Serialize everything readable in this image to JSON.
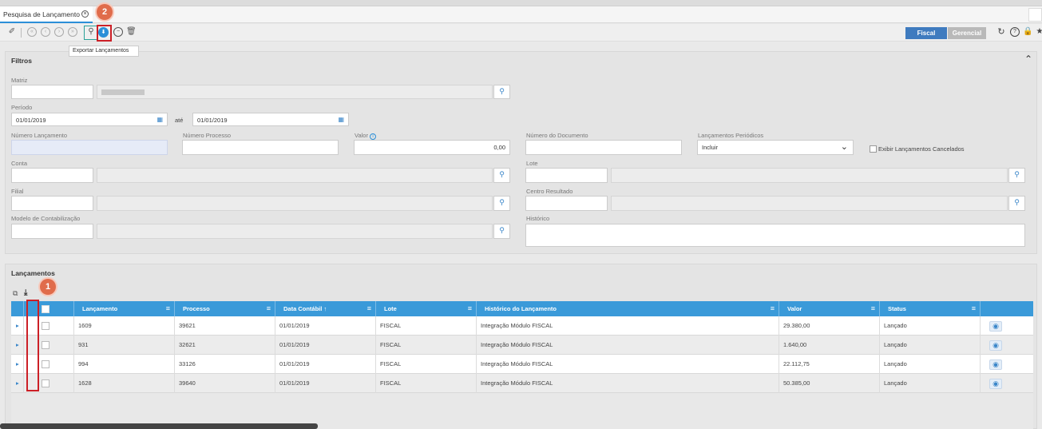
{
  "tab": {
    "title": "Pesquisa de Lançamento"
  },
  "annotations": {
    "badge1": "1",
    "badge2": "2"
  },
  "tooltip": "Exportar Lançamentos",
  "view_toggle": {
    "fiscal": "Fiscal",
    "gerencial": "Gerencial"
  },
  "filters": {
    "title": "Filtros",
    "matriz_label": "Matriz",
    "periodo_label": "Período",
    "periodo_de": "01/01/2019",
    "ate_label": "até",
    "periodo_ate": "01/01/2019",
    "numero_lancamento_label": "Número Lançamento",
    "numero_processo_label": "Número Processo",
    "valor_label": "Valor",
    "valor_value": "0,00",
    "numero_documento_label": "Número do Documento",
    "lanc_periodicos_label": "Lançamentos Periódicos",
    "lanc_periodicos_value": "Incluir",
    "exibir_cancelados_label": "Exibir Lançamentos Cancelados",
    "conta_label": "Conta",
    "lote_label": "Lote",
    "filial_label": "Filial",
    "centro_resultado_label": "Centro Resultado",
    "modelo_label": "Modelo de Contabilização",
    "historico_label": "Histórico"
  },
  "lancamentos": {
    "title": "Lançamentos",
    "columns": [
      "Lançamento",
      "Processo",
      "Data Contábil",
      "Lote",
      "Histórico do Lançamento",
      "Valor",
      "Status"
    ],
    "sort_indicator": "↑",
    "rows": [
      {
        "lancamento": "1609",
        "processo": "39621",
        "data": "01/01/2019",
        "lote": "FISCAL",
        "historico": "Integração Módulo FISCAL",
        "valor": "29.380,00",
        "status": "Lançado"
      },
      {
        "lancamento": "931",
        "processo": "32621",
        "data": "01/01/2019",
        "lote": "FISCAL",
        "historico": "Integração Módulo FISCAL",
        "valor": "1.640,00",
        "status": "Lançado"
      },
      {
        "lancamento": "994",
        "processo": "33126",
        "data": "01/01/2019",
        "lote": "FISCAL",
        "historico": "Integração Módulo FISCAL",
        "valor": "22.112,75",
        "status": "Lançado"
      },
      {
        "lancamento": "1628",
        "processo": "39640",
        "data": "01/01/2019",
        "lote": "FISCAL",
        "historico": "Integração Módulo FISCAL",
        "valor": "50.385,00",
        "status": "Lançado"
      }
    ]
  },
  "colors": {
    "accent": "#3a9ad9",
    "fiscal": "#3f7bbf",
    "badge": "#e06c4b",
    "highlight": "#cc1f26"
  }
}
